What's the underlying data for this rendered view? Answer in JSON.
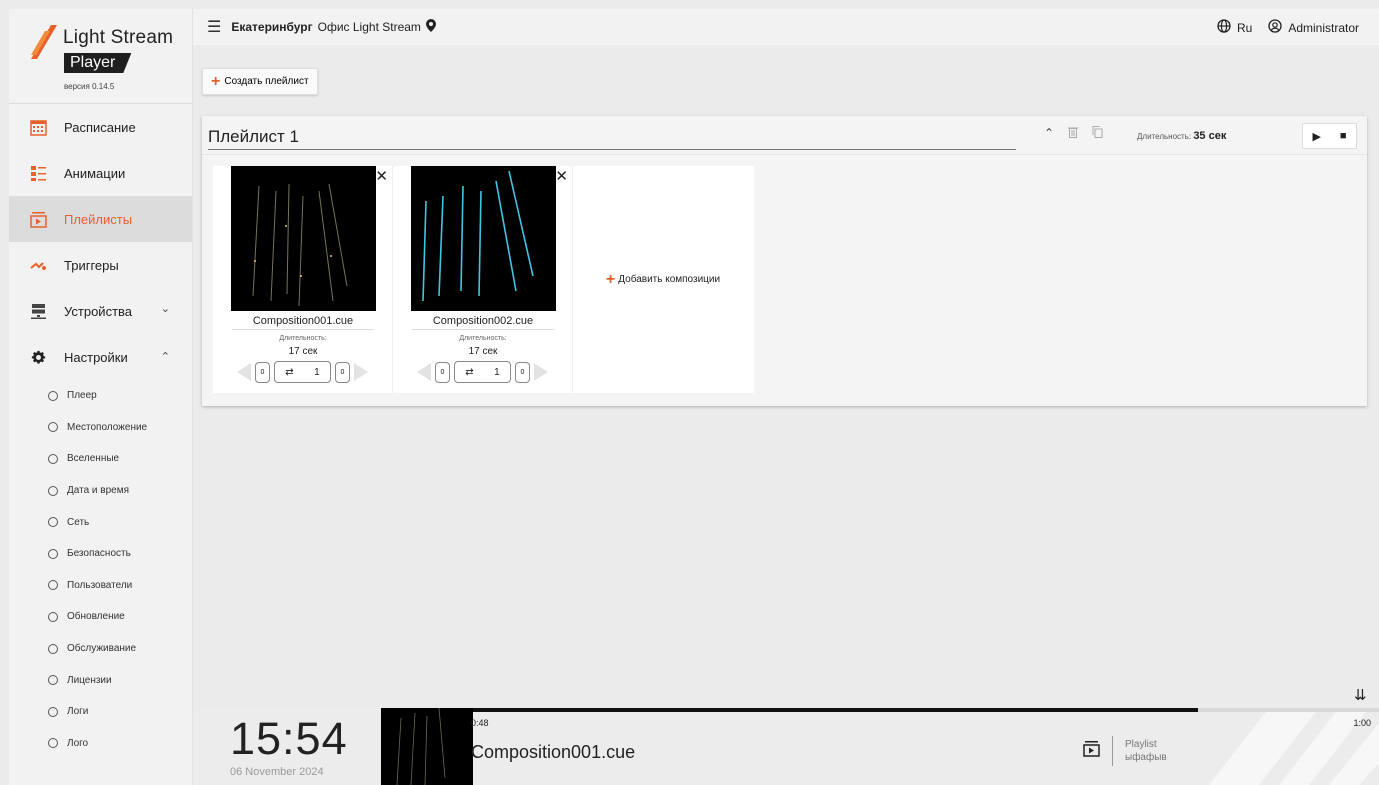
{
  "app": {
    "name": "Light Stream",
    "product": "Player",
    "version": "версия 0.14.5"
  },
  "sidebar": {
    "items": [
      {
        "label": "Расписание",
        "icon": "calendar-icon"
      },
      {
        "label": "Анимации",
        "icon": "animation-list-icon"
      },
      {
        "label": "Плейлисты",
        "icon": "playlist-icon",
        "active": true
      },
      {
        "label": "Триггеры",
        "icon": "trigger-icon"
      },
      {
        "label": "Устройства",
        "icon": "devices-icon"
      },
      {
        "label": "Настройки",
        "icon": "gear-icon"
      }
    ],
    "settings_sub": [
      "Плеер",
      "Местоположение",
      "Вселенные",
      "Дата и время",
      "Сеть",
      "Безопасность",
      "Пользователи",
      "Обновление",
      "Обслуживание",
      "Лицензии",
      "Логи",
      "Лого"
    ]
  },
  "topbar": {
    "city": "Екатеринбург",
    "office": "Офис Light Stream",
    "language": "Ru",
    "user": "Administrator"
  },
  "actions": {
    "create_playlist": "Создать плейлист"
  },
  "playlist": {
    "name": "Плейлист 1",
    "duration_label": "Длительность:",
    "duration_value": "35 сек",
    "add_compositions": "Добавить композиции",
    "compositions": [
      {
        "name": "Composition001.cue",
        "duration_label": "Длительность:",
        "duration": "17 сек",
        "fade_in": "0",
        "loops": "1",
        "fade_out": "0"
      },
      {
        "name": "Composition002.cue",
        "duration_label": "Длительность:",
        "duration": "17 сек",
        "fade_in": "0",
        "loops": "1",
        "fade_out": "0"
      }
    ]
  },
  "now_playing": {
    "time": "15:54",
    "date": "06 November 2024",
    "elapsed": "0:48",
    "total": "1:00",
    "progress_fraction": 0.8,
    "composition": "Composition001.cue",
    "playlist_label": "Playlist",
    "playlist_name": "ыфафыв"
  },
  "colors": {
    "accent": "#e8612c",
    "thumb_lines_1": "#e8e0b0",
    "thumb_lines_2": "#3fc7e0"
  }
}
